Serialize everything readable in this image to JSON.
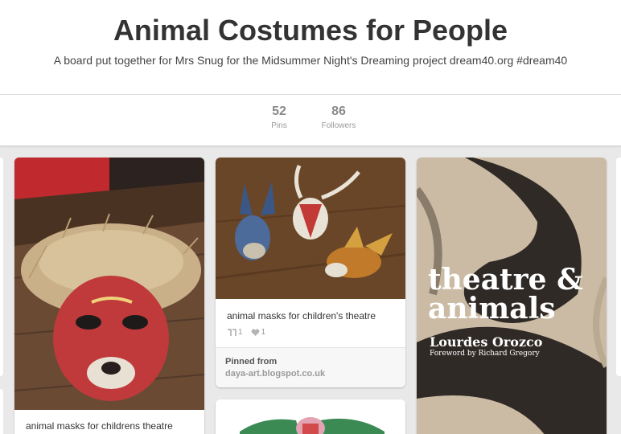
{
  "board": {
    "title": "Animal Costumes for People",
    "description": "A board put together for Mrs Snug for the Midsummer Night's Dreaming project dream40.org #dream40"
  },
  "stats": {
    "pins_count": "52",
    "pins_label": "Pins",
    "followers_count": "86",
    "followers_label": "Followers"
  },
  "pins": [
    {
      "description": "animal masks for childrens theatre",
      "image": "lion-mask-photo"
    },
    {
      "description": "animal masks for children's theatre",
      "repins": "1",
      "likes": "1",
      "pinned_from_label": "Pinned from",
      "source": "daya-art.blogspot.co.uk",
      "image": "three-masks-photo",
      "icons": {
        "repin": "repin-icon",
        "like": "heart-icon"
      }
    },
    {
      "image": "book-cover-photo",
      "book_title_line1": "theatre &",
      "book_title_line2": "animals",
      "book_author": "Lourdes Orozco",
      "book_foreword": "Foreword by Richard Gregory"
    },
    {
      "image": "costume-photo"
    }
  ],
  "colors": {
    "background": "#e9e9e9",
    "card": "#ffffff",
    "title_text": "#333333",
    "muted_text": "#9a9a9a"
  }
}
